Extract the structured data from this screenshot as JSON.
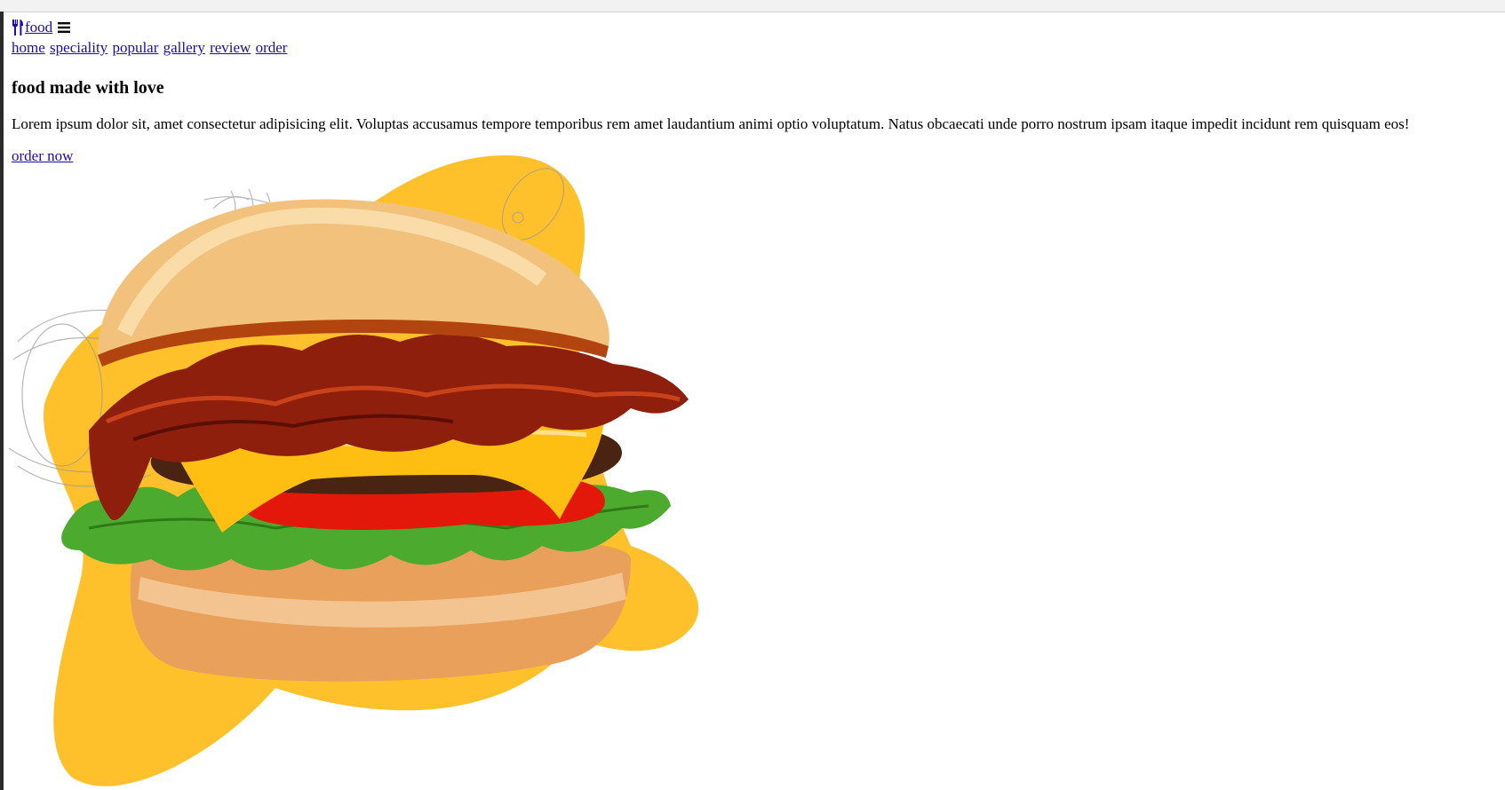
{
  "header": {
    "logo_text": "food",
    "logo_icon": "utensils-icon",
    "menu_icon": "hamburger-menu-icon"
  },
  "nav": {
    "items": [
      {
        "label": "home"
      },
      {
        "label": "speciality"
      },
      {
        "label": "popular"
      },
      {
        "label": "gallery"
      },
      {
        "label": "review"
      },
      {
        "label": "order"
      }
    ]
  },
  "hero": {
    "title": "food made with love",
    "text": "Lorem ipsum dolor sit, amet consectetur adipisicing elit. Voluptas accusamus tempore temporibus rem amet laudantium animi optio voluptatum. Natus obcaecati unde porro nostrum ipsam itaque impedit incidunt rem quisquam eos!",
    "cta_label": "order now",
    "image": "burger-image"
  },
  "colors": {
    "link": "#1a0dab",
    "accent_blob": "#ffc12b"
  }
}
